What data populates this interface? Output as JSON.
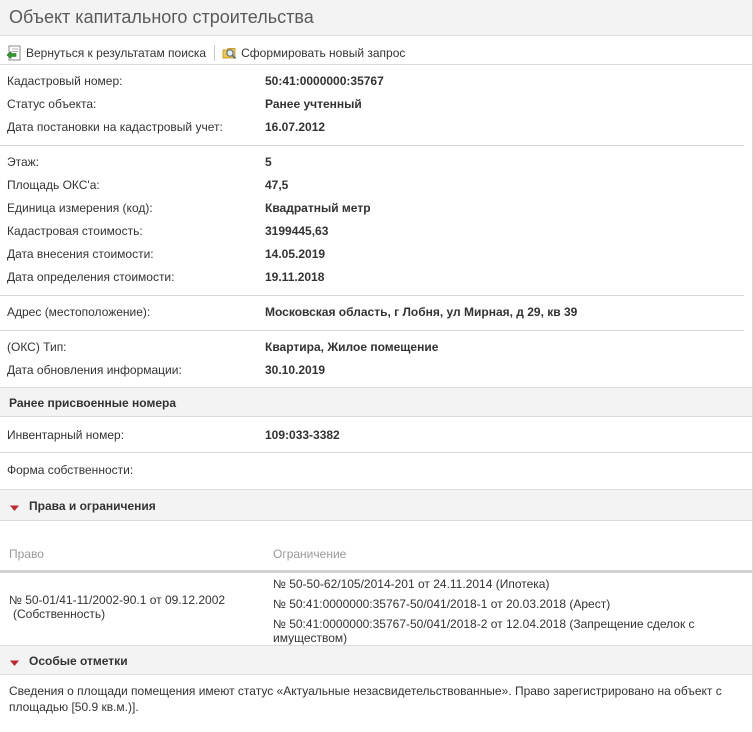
{
  "window": {
    "title": "Объект капитального строительства"
  },
  "toolbar": {
    "back_label": "Вернуться к результатам поиска",
    "new_query_label": "Сформировать новый запрос"
  },
  "group1": [
    {
      "label": "Кадастровый номер:",
      "value": "50:41:0000000:35767"
    },
    {
      "label": "Статус объекта:",
      "value": "Ранее учтенный"
    },
    {
      "label": "Дата постановки на кадастровый учет:",
      "value": "16.07.2012"
    }
  ],
  "group2": [
    {
      "label": "Этаж:",
      "value": "5"
    },
    {
      "label": "Площадь ОКС'а:",
      "value": "47,5"
    },
    {
      "label": "Единица измерения (код):",
      "value": "Квадратный метр"
    },
    {
      "label": "Кадастровая стоимость:",
      "value": "3199445,63"
    },
    {
      "label": "Дата внесения стоимости:",
      "value": "14.05.2019"
    },
    {
      "label": "Дата определения стоимости:",
      "value": "19.11.2018"
    }
  ],
  "group3": [
    {
      "label": "Адрес (местоположение):",
      "value": "Московская область, г Лобня, ул Мирная, д 29, кв 39"
    }
  ],
  "group4": [
    {
      "label": "(ОКС) Тип:",
      "value": "Квартира, Жилое помещение"
    },
    {
      "label": "Дата обновления информации:",
      "value": "30.10.2019"
    }
  ],
  "prev_numbers": {
    "header": "Ранее присвоенные номера",
    "inventory_label": "Инвентарный номер:",
    "inventory_value": "109:033-3382"
  },
  "ownership": {
    "label": "Форма собственности:",
    "value": ""
  },
  "rights": {
    "header": "Права и ограничения",
    "col_right": "Право",
    "col_limit": "Ограничение",
    "right_line1": "№ 50-01/41-11/2002-90.1  от 09.12.2002",
    "right_line2": "(Собственность)",
    "limits": [
      "№ 50-50-62/105/2014-201  от 24.11.2014  (Ипотека)",
      "№ 50:41:0000000:35767-50/041/2018-1  от 20.03.2018  (Арест)",
      "№ 50:41:0000000:35767-50/041/2018-2  от 12.04.2018  (Запрещение сделок с имуществом)"
    ]
  },
  "notes": {
    "header": "Особые отметки",
    "text": "Сведения о площади помещения имеют статус «Актуальные незасвидетельствованные». Право зарегистрировано на объект с площадью [50.9 кв.м.)]."
  },
  "colors": {
    "accent_red": "#c0272d",
    "header_bg": "#f3f3f3",
    "border": "#dcdcdc"
  },
  "icons": {
    "back": "arrow-back-icon",
    "new_query": "magnifier-query-icon",
    "expand": "triangle-down-icon"
  }
}
